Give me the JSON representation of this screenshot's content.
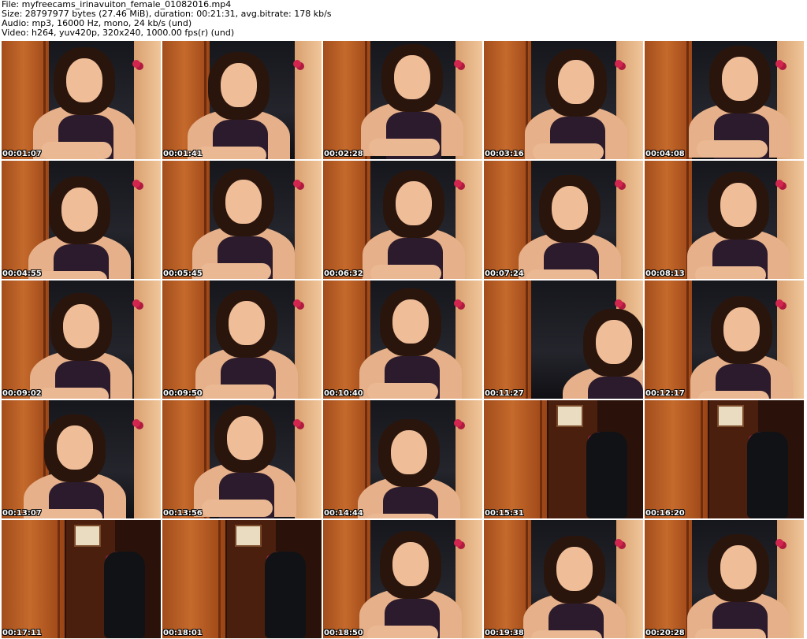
{
  "header": {
    "line1": "File: myfreecams_irinavuiton_female_01082016.mp4",
    "line2": "Size: 28797977 bytes (27.46 MiB), duration: 00:21:31, avg.bitrate: 178 kb/s",
    "line3": "Audio: mp3, 16000 Hz, mono, 24 kb/s (und)",
    "line4": "Video: h264, yuv420p, 320x240, 1000.00 fps(r) (und)"
  },
  "thumbnails": [
    {
      "timestamp": "00:01:07",
      "scene": "person"
    },
    {
      "timestamp": "00:01:41",
      "scene": "person"
    },
    {
      "timestamp": "00:02:28",
      "scene": "person"
    },
    {
      "timestamp": "00:03:16",
      "scene": "person"
    },
    {
      "timestamp": "00:04:08",
      "scene": "person"
    },
    {
      "timestamp": "00:04:55",
      "scene": "person"
    },
    {
      "timestamp": "00:05:45",
      "scene": "person"
    },
    {
      "timestamp": "00:06:32",
      "scene": "person"
    },
    {
      "timestamp": "00:07:24",
      "scene": "person"
    },
    {
      "timestamp": "00:08:13",
      "scene": "person"
    },
    {
      "timestamp": "00:09:02",
      "scene": "person"
    },
    {
      "timestamp": "00:09:50",
      "scene": "person"
    },
    {
      "timestamp": "00:10:40",
      "scene": "person"
    },
    {
      "timestamp": "00:11:27",
      "scene": "person-leaning"
    },
    {
      "timestamp": "00:12:17",
      "scene": "person"
    },
    {
      "timestamp": "00:13:07",
      "scene": "person"
    },
    {
      "timestamp": "00:13:56",
      "scene": "person"
    },
    {
      "timestamp": "00:14:44",
      "scene": "person"
    },
    {
      "timestamp": "00:15:31",
      "scene": "empty-room"
    },
    {
      "timestamp": "00:16:20",
      "scene": "empty-room"
    },
    {
      "timestamp": "00:17:11",
      "scene": "empty-room"
    },
    {
      "timestamp": "00:18:01",
      "scene": "empty-room"
    },
    {
      "timestamp": "00:18:50",
      "scene": "person"
    },
    {
      "timestamp": "00:19:38",
      "scene": "person"
    },
    {
      "timestamp": "00:20:28",
      "scene": "person"
    }
  ],
  "colors": {
    "timestamp_text": "#ffffff",
    "timestamp_outline": "#000000",
    "header_text": "#000000",
    "background": "#ffffff"
  }
}
